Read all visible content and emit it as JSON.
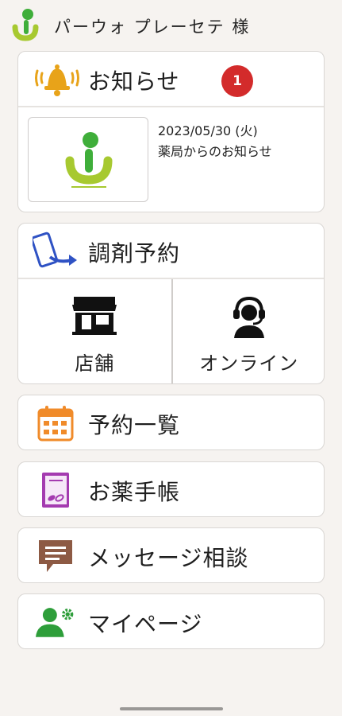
{
  "header": {
    "user_name": "パーウォ プレーセテ 様",
    "logo_icon": "pharmacy-logo-icon"
  },
  "notice": {
    "title": "お知らせ",
    "unread_count": "1",
    "items": [
      {
        "date": "2023/05/30 (火)",
        "text": "薬局からのお知らせ",
        "thumbnail_icon": "pharmacy-logo-icon"
      }
    ],
    "icon": "bell-icon"
  },
  "reservation": {
    "title": "調剤予約",
    "icon": "phone-send-icon",
    "options": [
      {
        "label": "店舗",
        "icon": "store-icon"
      },
      {
        "label": "オンライン",
        "icon": "headset-operator-icon"
      }
    ]
  },
  "menu": {
    "list_label": "予約一覧",
    "handbook_label": "お薬手帳",
    "message_label": "メッセージ相談",
    "mypage_label": "マイページ"
  },
  "colors": {
    "background": "#f6f3f0",
    "badge": "#d32b2b",
    "logo_green": "#3fae3a",
    "logo_lime": "#a7c930",
    "bell": "#e8a319",
    "calendar": "#f08b2a",
    "handbook": "#a43bb0",
    "message": "#8d5a44",
    "mypage": "#2e9e3a",
    "phone": "#2f52c4"
  }
}
